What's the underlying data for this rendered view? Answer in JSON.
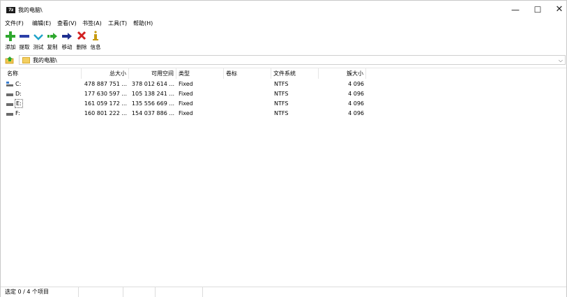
{
  "window": {
    "title": "我的电脑\\",
    "app_icon_text": "7z",
    "minimize_glyph": "—",
    "maximize_glyph": "☐",
    "close_glyph": "✕"
  },
  "menu": [
    {
      "label": "文件(F)"
    },
    {
      "label": "编辑(E)"
    },
    {
      "label": "查看(V)"
    },
    {
      "label": "书签(A)"
    },
    {
      "label": "工具(T)"
    },
    {
      "label": "帮助(H)"
    }
  ],
  "toolbar": [
    {
      "label": "添加",
      "icon": "plus-icon",
      "color": "#2fa82f"
    },
    {
      "label": "提取",
      "icon": "minus-icon",
      "color": "#2b3fa8"
    },
    {
      "label": "测试",
      "icon": "checkmark-icon",
      "color": "#1fa3c8"
    },
    {
      "label": "复制",
      "icon": "copy-arrow-icon",
      "color": "#2fa82f"
    },
    {
      "label": "移动",
      "icon": "move-arrow-icon",
      "color": "#1e2f8f"
    },
    {
      "label": "删除",
      "icon": "delete-x-icon",
      "color": "#d22020"
    },
    {
      "label": "信息",
      "icon": "info-icon",
      "color": "#c79a10"
    }
  ],
  "address": {
    "path": "我的电脑\\",
    "dropdown_glyph": "⌵"
  },
  "columns": [
    {
      "label": "名称"
    },
    {
      "label": "总大小"
    },
    {
      "label": "可用空间"
    },
    {
      "label": "类型"
    },
    {
      "label": "卷标"
    },
    {
      "label": "文件系统"
    },
    {
      "label": "簇大小"
    }
  ],
  "drives": [
    {
      "name": "C:",
      "total": "478 887 751 ...",
      "free": "378 012 614 ...",
      "type": "Fixed",
      "label": "",
      "fs": "NTFS",
      "cluster": "4 096"
    },
    {
      "name": "D:",
      "total": "177 630 597 ...",
      "free": "105 138 241 ...",
      "type": "Fixed",
      "label": "",
      "fs": "NTFS",
      "cluster": "4 096"
    },
    {
      "name": "E:",
      "total": "161 059 172 ...",
      "free": "135 556 669 ...",
      "type": "Fixed",
      "label": "",
      "fs": "NTFS",
      "cluster": "4 096"
    },
    {
      "name": "F:",
      "total": "160 801 222 ...",
      "free": "154 037 886 ...",
      "type": "Fixed",
      "label": "",
      "fs": "NTFS",
      "cluster": "4 096"
    }
  ],
  "status": {
    "text": "选定 0 / 4 个项目"
  }
}
